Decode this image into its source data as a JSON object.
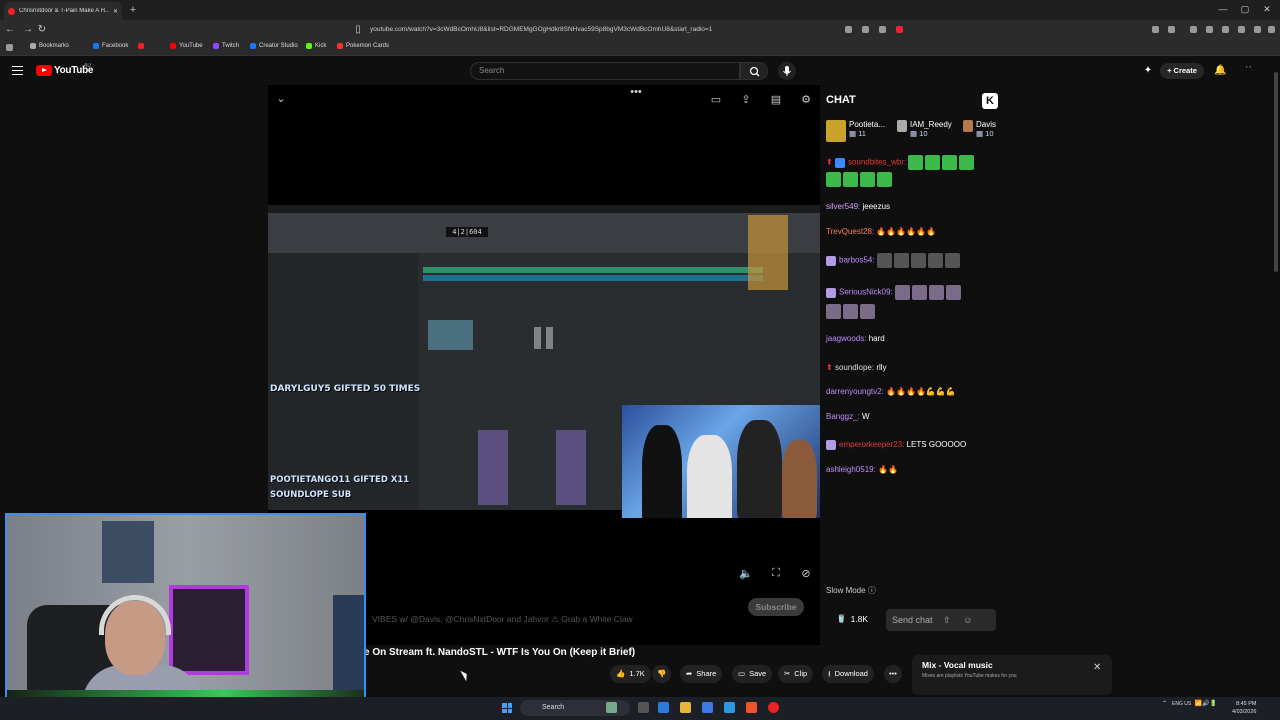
{
  "browser": {
    "tab_title": "Chrisnxtdoor & T-Pain Make A H...",
    "new_tab": "+",
    "url": "youtube.com/watch?v=3cWdBcOmhU8&list=RDGMEMgGOgHdkr8SNHvac59Sp8bgVM3cWdBcOmhU8&start_radio=1",
    "bookmarks": [
      "Bookmarks",
      "Facebook",
      "YouTube",
      "Twitch",
      "Creator Studio",
      "Kick",
      "Pokemon Cards"
    ]
  },
  "youtube": {
    "logo": "YouTube",
    "region": "AU",
    "search_placeholder": "Search",
    "create_label": "Create"
  },
  "video": {
    "overlay_lines": [
      "DARYLGUY5 GIFTED 50 TIMES",
      "POOTIETANGO11  GIFTED X11",
      "SOUNDLOPE  SUB"
    ],
    "daw_counter": "4|2|604",
    "subscribe_label": "Subscribe",
    "description_snippet": "VIBES w/ @Davis, @ChrisNxtDoor and Jahvor ⚠ Grab a White Claw",
    "title": "e On Stream ft. NandoSTL - WTF Is You On (Keep it Brief)",
    "actions": {
      "likes": "1.7K",
      "share": "Share",
      "save": "Save",
      "clip": "Clip",
      "download": "Download"
    }
  },
  "chat": {
    "header": "CHAT",
    "top_gifters": [
      {
        "name": "Pootieta...",
        "count": "11"
      },
      {
        "name": "IAM_Reedy",
        "count": "10"
      },
      {
        "name": "Davis",
        "count": "10"
      }
    ],
    "messages": [
      {
        "user": "soundbites_wbr:",
        "text": "",
        "color": "#e03a3a"
      },
      {
        "user": "silver549:",
        "text": "jeeezus",
        "color": "#d2a2ff"
      },
      {
        "user": "TrevQuest28:",
        "text": "🔥🔥🔥🔥🔥🔥",
        "color": "#ff7a59"
      },
      {
        "user": "barbos54:",
        "text": "",
        "color": "#c08cff"
      },
      {
        "user": "SeriousNick09:",
        "text": "",
        "color": "#c08cff"
      },
      {
        "user": "jaagwoods:",
        "text": "hard",
        "color": "#c08cff"
      },
      {
        "user": "soundlope:",
        "text": "rlly",
        "color": "#ddd"
      },
      {
        "user": "darrenyoungtv2:",
        "text": "🔥🔥🔥🔥💪💪💪",
        "color": "#c08cff"
      },
      {
        "user": "Banggz_:",
        "text": "W",
        "color": "#c08cff"
      },
      {
        "user": "emperorkeeper23:",
        "text": "LETS GOOOOO",
        "color": "#e03a3a"
      },
      {
        "user": "ashleigh0519:",
        "text": "🔥🔥",
        "color": "#c08cff"
      }
    ],
    "slow_mode": "Slow Mode",
    "viewer_count": "1.8K",
    "input_placeholder": "Send chat"
  },
  "mix": {
    "title": "Mix - Vocal music",
    "subtitle": "Mixes are playlists YouTube makes for you",
    "close": "✕"
  },
  "taskbar": {
    "search": "Search",
    "lang": "ENG\nUS",
    "time": "8:45 PM",
    "date": "4/03/2026"
  },
  "colors": {
    "accent_red": "#ff0000",
    "webcam_border": "#3b8ef5",
    "kick_green": "#53fc18"
  }
}
